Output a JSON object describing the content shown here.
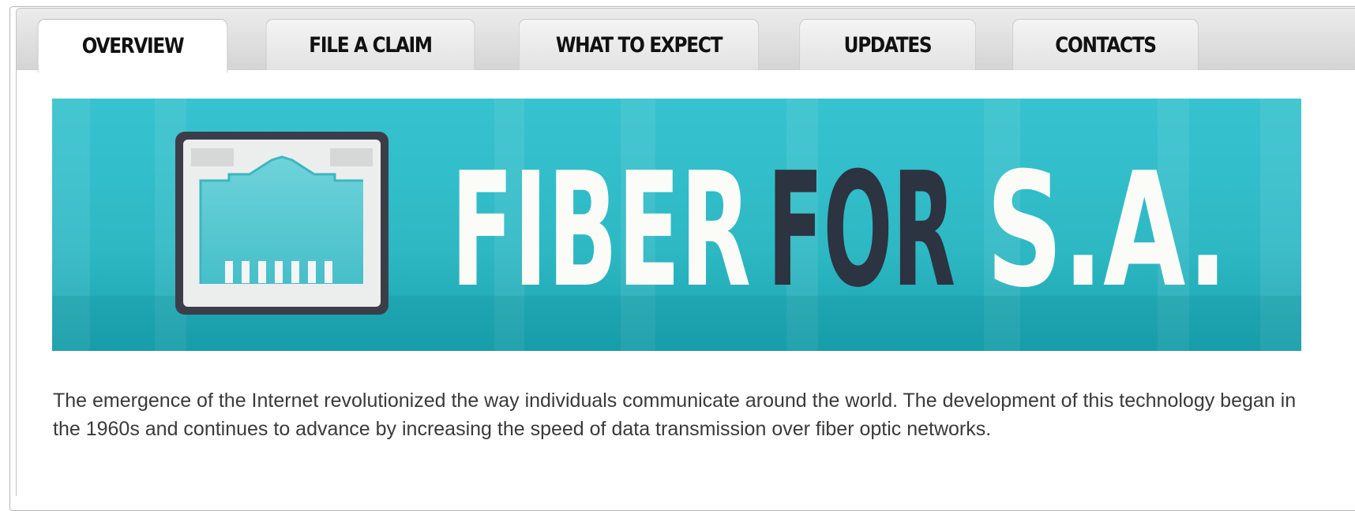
{
  "tabs": [
    {
      "label": "OVERVIEW",
      "active": true
    },
    {
      "label": "FILE A CLAIM",
      "active": false
    },
    {
      "label": "WHAT TO EXPECT",
      "active": false
    },
    {
      "label": "UPDATES",
      "active": false
    },
    {
      "label": "CONTACTS",
      "active": false
    }
  ],
  "banner": {
    "word_fiber": "FIBER",
    "word_for": "FOR",
    "word_sa": "S.A.",
    "icon": "ethernet-port-icon",
    "colors": {
      "background_top": "#36c3cf",
      "background_bottom": "#1aa7b2",
      "text_light": "#fbfcf7",
      "text_dark": "#2c3341",
      "port_frame": "#3b3e48",
      "port_body": "#53c6cf"
    }
  },
  "intro": {
    "text": "The emergence of the Internet revolutionized the way individuals communicate around the world. The development of this technology began in the 1960s and continues to advance by increasing the speed of data transmission over fiber optic networks."
  }
}
